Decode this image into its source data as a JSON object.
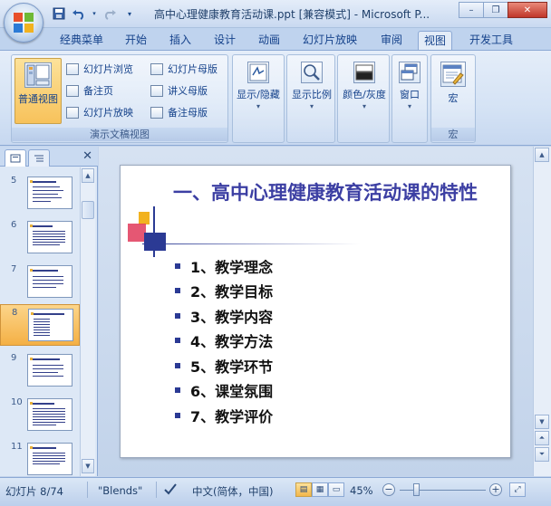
{
  "window": {
    "title": "高中心理健康教育活动课.ppt [兼容模式] - Microsoft P...",
    "controls": {
      "minimize": "–",
      "restore": "❐",
      "close": "✕"
    }
  },
  "qat": {
    "save_icon": "save-icon",
    "undo_icon": "undo-icon",
    "redo_icon": "redo-icon",
    "customize_icon": "customize-qat-icon"
  },
  "tabs": [
    {
      "label": "经典菜单"
    },
    {
      "label": "开始"
    },
    {
      "label": "插入"
    },
    {
      "label": "设计"
    },
    {
      "label": "动画"
    },
    {
      "label": "幻灯片放映"
    },
    {
      "label": "审阅"
    },
    {
      "label": "视图",
      "active": true
    },
    {
      "label": "开发工具"
    }
  ],
  "ribbon": {
    "presentation_views": {
      "group_label": "演示文稿视图",
      "normal": "普通视图",
      "slide_sorter": "幻灯片浏览",
      "notes_page": "备注页",
      "slide_show": "幻灯片放映",
      "slide_master": "幻灯片母版",
      "handout_master": "讲义母版",
      "notes_master": "备注母版"
    },
    "show_hide": "显示/隐藏",
    "zoom": "显示比例",
    "color_grayscale": "颜色/灰度",
    "window": "窗口",
    "macros": {
      "button": "宏",
      "group_label": "宏"
    }
  },
  "left_panel": {
    "close": "✕",
    "thumbnails": [
      {
        "num": "5"
      },
      {
        "num": "6"
      },
      {
        "num": "7"
      },
      {
        "num": "8",
        "selected": true
      },
      {
        "num": "9"
      },
      {
        "num": "10"
      },
      {
        "num": "11"
      }
    ]
  },
  "slide": {
    "title": "一、高中心理健康教育活动课的特性",
    "bullets": [
      "1、教学理念",
      "2、教学目标",
      "3、教学内容",
      "4、教学方法",
      "5、教学环节",
      "6、课堂氛围",
      "7、教学评价"
    ]
  },
  "statusbar": {
    "slide_info": "幻灯片 8/74",
    "theme": "\"Blends\"",
    "language": "中文(简体，中国)",
    "zoom_level": "45%",
    "zoom_fraction": 0.45
  },
  "colors": {
    "accent_tab": "#e3ecf8",
    "selected": "#f7c25b",
    "title_text": "#3c3fa3",
    "bullet_mark": "#2b3a94"
  }
}
